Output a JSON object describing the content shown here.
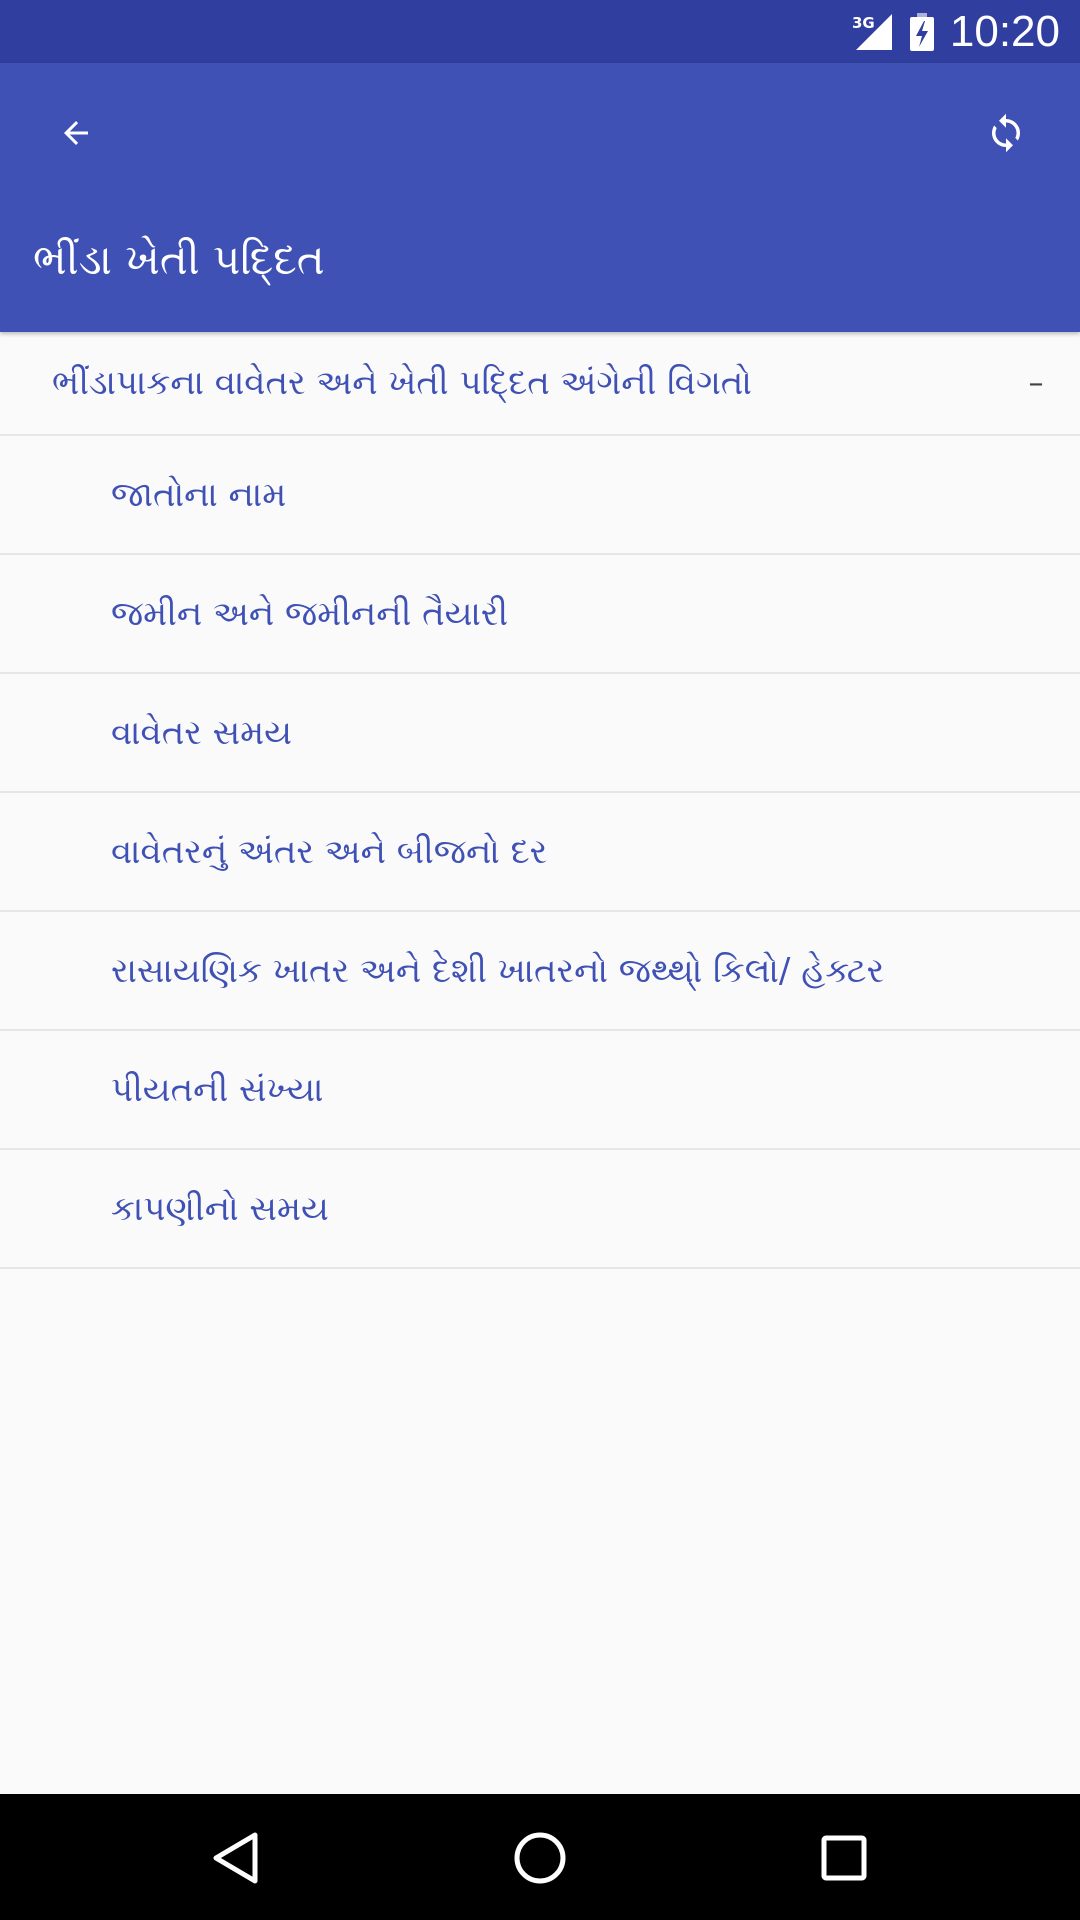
{
  "status_bar": {
    "network": "3G",
    "time": "10:20"
  },
  "toolbar": {
    "title": "ભીંડા ખેતી પદ્દિત",
    "back_icon": "arrow-back-icon",
    "refresh_icon": "refresh-icon"
  },
  "group": {
    "title": "ભીંડાપાકના વાવેતર અને ખેતી પદ્દિત અંગેની વિગતો",
    "indicator": "–"
  },
  "items": [
    {
      "label": "જાતોના નામ"
    },
    {
      "label": "જમીન અને જમીનની તૈયારી"
    },
    {
      "label": "વાવેતર સમય"
    },
    {
      "label": "વાવેતરનું અંતર અને બીજનો દર"
    },
    {
      "label": "રાસાયણિક ખાતર અને દેશી ખાતરનો જથ્થો્ કિલો/ હેક્ટર"
    },
    {
      "label": "પીયતની સંખ્યા"
    },
    {
      "label": "કાપણીનો સમય"
    }
  ],
  "colors": {
    "status_bar": "#303f9f",
    "app_bar": "#3f51b5",
    "accent_text": "#3f51b5",
    "background": "#fafafa"
  }
}
